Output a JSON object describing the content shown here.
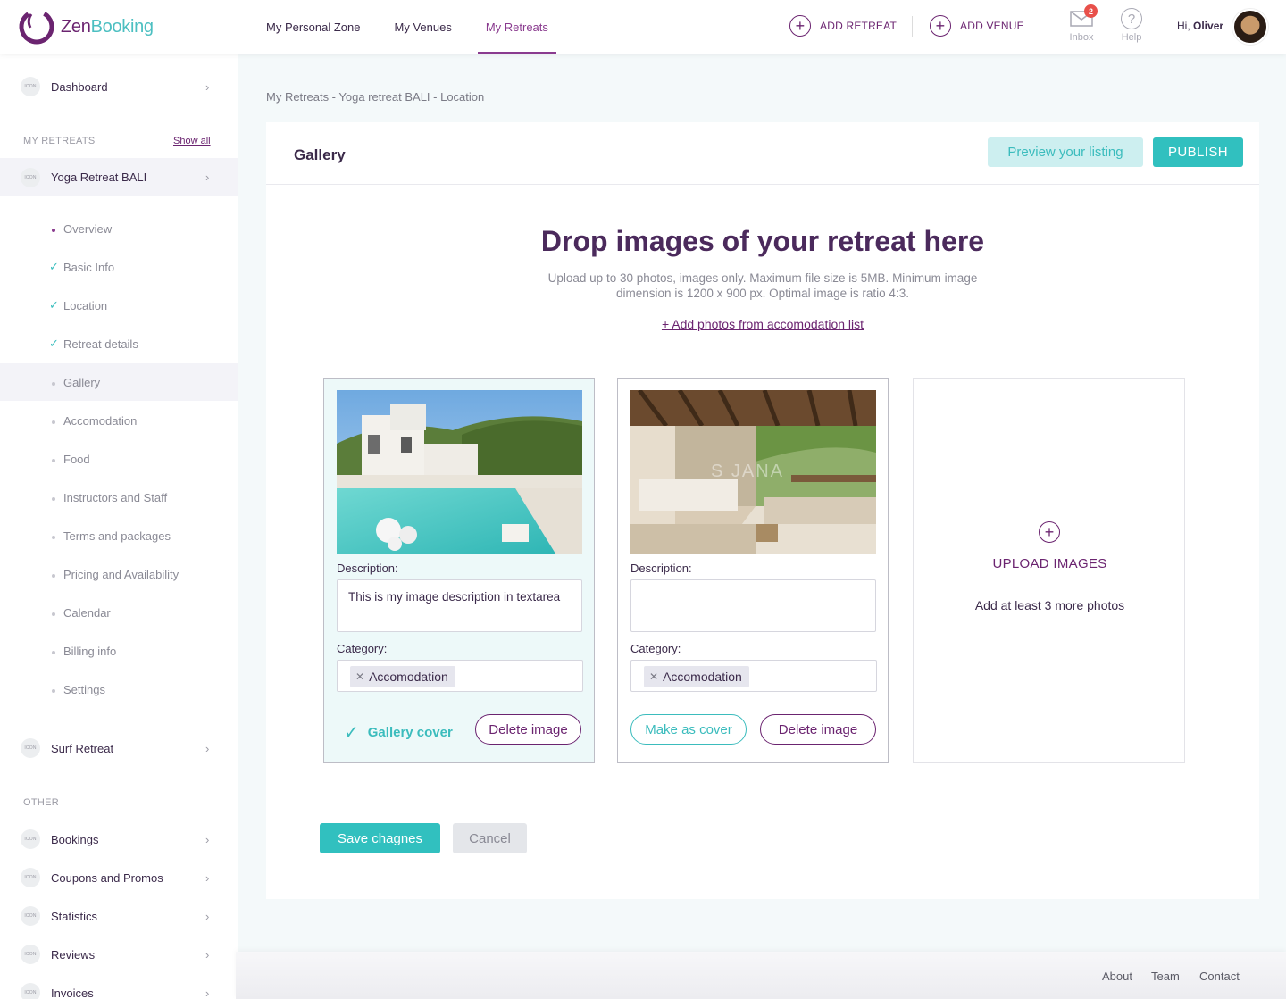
{
  "brand": {
    "name_part1": "Zen",
    "name_part2": "Booking",
    "accent": "#6b2470",
    "teal": "#31c0bf"
  },
  "nav": {
    "items": [
      {
        "label": "My Personal Zone",
        "active": false
      },
      {
        "label": "My Venues",
        "active": false
      },
      {
        "label": "My Retreats",
        "active": true
      }
    ],
    "add_retreat": "ADD RETREAT",
    "add_venue": "ADD VENUE",
    "inbox_label": "Inbox",
    "inbox_count": "2",
    "help_label": "Help",
    "greeting": "Hi,",
    "user_name": "Oliver"
  },
  "sidebar": {
    "dashboard": "Dashboard",
    "icon_text": "ICON",
    "my_retreats_section": "MY RETREATS",
    "show_all": "Show all",
    "current_retreat": "Yoga Retreat BALI",
    "sub_items": [
      {
        "label": "Overview",
        "state": "active-dot"
      },
      {
        "label": "Basic Info",
        "state": "done"
      },
      {
        "label": "Location",
        "state": "done"
      },
      {
        "label": "Retreat details",
        "state": "done"
      },
      {
        "label": "Gallery",
        "state": "current"
      },
      {
        "label": "Accomodation",
        "state": "dot"
      },
      {
        "label": "Food",
        "state": "dot"
      },
      {
        "label": "Instructors and Staff",
        "state": "dot"
      },
      {
        "label": "Terms and packages",
        "state": "dot"
      },
      {
        "label": "Pricing and Availability",
        "state": "dot"
      },
      {
        "label": "Calendar",
        "state": "dot"
      },
      {
        "label": "Billing info",
        "state": "dot"
      },
      {
        "label": "Settings",
        "state": "dot"
      }
    ],
    "other_retreat": "Surf Retreat",
    "other_section": "OTHER",
    "other_items": [
      "Bookings",
      "Coupons and Promos",
      "Statistics",
      "Reviews",
      "Invoices"
    ]
  },
  "breadcrumb": "My Retreats - Yoga retreat BALI - Location",
  "gallery": {
    "title": "Gallery",
    "preview_label": "Preview your listing",
    "publish_label": "PUBLISH",
    "drop_title": "Drop images of your retreat here",
    "drop_desc": "Upload up to 30 photos, images only. Maximum file size is 5MB. Minimum image dimension is 1200 x 900 px. Optimal image is ratio 4:3.",
    "add_from_list": "+ Add photos from accomodation list",
    "description_label": "Description:",
    "category_label": "Category:",
    "images": [
      {
        "description": "This is my image description in textarea",
        "category": "Accomodation",
        "cover_label": "Gallery cover",
        "delete_label": "Delete image"
      },
      {
        "description": "",
        "category": "Accomodation",
        "make_cover_label": "Make as cover",
        "delete_label": "Delete image",
        "watermark": "S  JANA"
      }
    ],
    "upload_title": "UPLOAD IMAGES",
    "upload_sub": "Add at least 3 more photos",
    "save_label": "Save chagnes",
    "cancel_label": "Cancel"
  },
  "footer": {
    "about": "About",
    "team": "Team",
    "contact": "Contact"
  }
}
